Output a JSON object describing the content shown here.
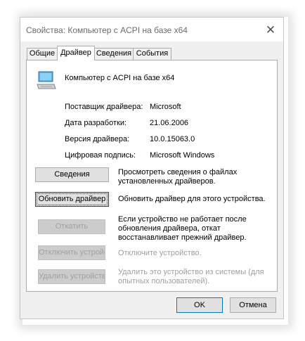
{
  "window": {
    "title": "Свойства: Компьютер с ACPI на базе x64",
    "close_glyph": "✕"
  },
  "tabs": [
    {
      "label": "Общие",
      "active": false
    },
    {
      "label": "Драйвер",
      "active": true
    },
    {
      "label": "Сведения",
      "active": false
    },
    {
      "label": "События",
      "active": false
    }
  ],
  "device": {
    "name": "Компьютер с ACPI на базе x64",
    "icon": "computer-icon"
  },
  "properties": [
    {
      "label": "Поставщик драйвера:",
      "value": "Microsoft"
    },
    {
      "label": "Дата разработки:",
      "value": "21.06.2006"
    },
    {
      "label": "Версия драйвера:",
      "value": "10.0.15063.0"
    },
    {
      "label": "Цифровая подпись:",
      "value": "Microsoft Windows"
    }
  ],
  "actions": [
    {
      "button": "Сведения",
      "description": "Просмотреть сведения о файлах установленных драйверов.",
      "enabled": true
    },
    {
      "button": "Обновить драйвер",
      "description": "Обновить драйвер для этого устройства.",
      "enabled": true
    },
    {
      "button": "Откатить",
      "description": "Если устройство не работает после обновления драйвера, откат восстанавливает прежний драйвер.",
      "enabled": false
    },
    {
      "button": "Отключить устройство",
      "description": "Отключите устройство.",
      "enabled": false
    },
    {
      "button": "Удалить устройство",
      "description": "Удалить это устройство из системы (для опытных пользователей).",
      "enabled": false
    }
  ],
  "footer": {
    "ok_label": "OK",
    "cancel_label": "Отмена"
  },
  "colors": {
    "dialog_bg": "#f0f0f0",
    "disabled_text": "#a0a0a0",
    "focus_border": "#0078d7"
  }
}
